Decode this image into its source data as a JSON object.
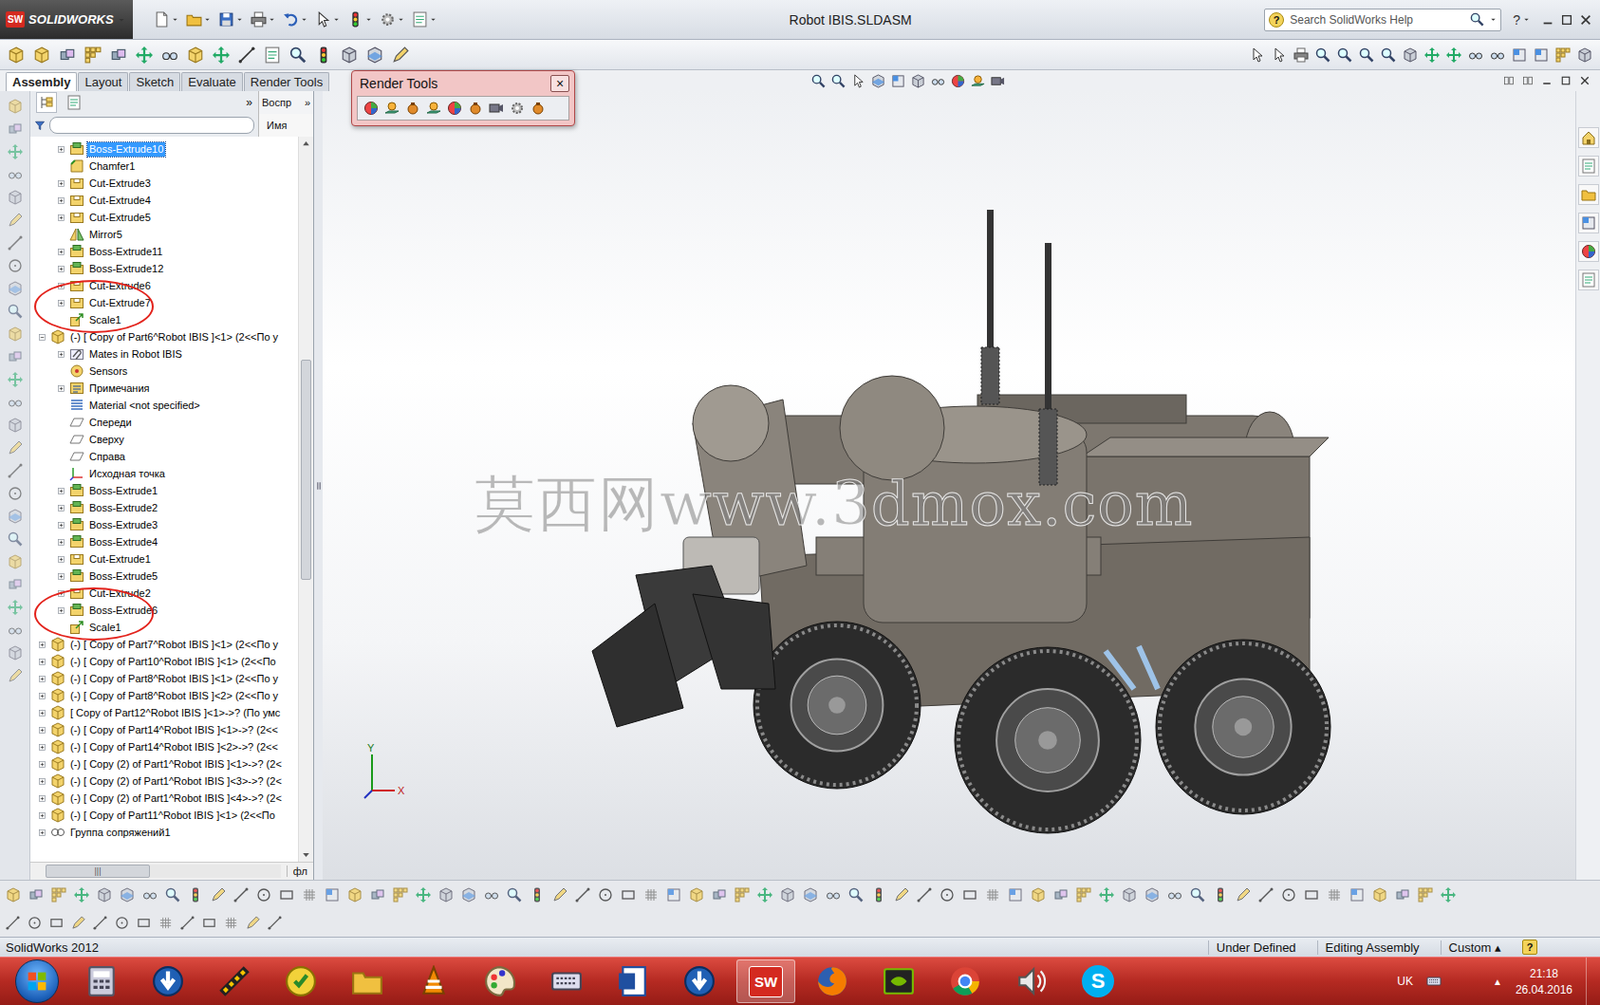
{
  "window": {
    "title": "Robot IBIS.SLDASM",
    "app_name": "SOLIDWORKS",
    "logo_mark": "SW",
    "help_glyph": "?"
  },
  "search": {
    "placeholder": "Search SolidWorks Help"
  },
  "tabs": [
    {
      "label": "Assembly",
      "selected": true
    },
    {
      "label": "Layout",
      "selected": false
    },
    {
      "label": "Sketch",
      "selected": false
    },
    {
      "label": "Evaluate",
      "selected": false
    },
    {
      "label": "Render Tools",
      "selected": false
    }
  ],
  "render_tools_toolbar": {
    "title": "Render Tools",
    "close": "×"
  },
  "panel": {
    "collapse_glyph": "»",
    "display_pane_title": "Воспр",
    "display_pane_column": "Имя",
    "bottom_label": "фл",
    "scroll_thumb": "|||"
  },
  "tree": [
    {
      "label": "Boss-Extrude10",
      "level": 2,
      "kind": "extrude",
      "expandable": true,
      "expanded": false,
      "selected": true,
      "circled": false
    },
    {
      "label": "Chamfer1",
      "level": 2,
      "kind": "chamfer",
      "expandable": false,
      "expanded": false,
      "selected": false,
      "circled": false
    },
    {
      "label": "Cut-Extrude3",
      "level": 2,
      "kind": "cut",
      "expandable": true,
      "expanded": false,
      "selected": false,
      "circled": false
    },
    {
      "label": "Cut-Extrude4",
      "level": 2,
      "kind": "cut",
      "expandable": true,
      "expanded": false,
      "selected": false,
      "circled": false
    },
    {
      "label": "Cut-Extrude5",
      "level": 2,
      "kind": "cut",
      "expandable": true,
      "expanded": false,
      "selected": false,
      "circled": false
    },
    {
      "label": "Mirror5",
      "level": 2,
      "kind": "mirror",
      "expandable": false,
      "expanded": false,
      "selected": false,
      "circled": false
    },
    {
      "label": "Boss-Extrude11",
      "level": 2,
      "kind": "extrude",
      "expandable": true,
      "expanded": false,
      "selected": false,
      "circled": false
    },
    {
      "label": "Boss-Extrude12",
      "level": 2,
      "kind": "extrude",
      "expandable": true,
      "expanded": false,
      "selected": false,
      "circled": false
    },
    {
      "label": "Cut-Extrude6",
      "level": 2,
      "kind": "cut",
      "expandable": true,
      "expanded": false,
      "selected": false,
      "circled": false
    },
    {
      "label": "Cut-Extrude7",
      "level": 2,
      "kind": "cut",
      "expandable": true,
      "expanded": false,
      "selected": false,
      "circled": false
    },
    {
      "label": "Scale1",
      "level": 2,
      "kind": "scale",
      "expandable": false,
      "expanded": false,
      "selected": false,
      "circled": true
    },
    {
      "label": "(-) [ Copy of Part6^Robot IBIS ]<1> (2<<По у",
      "level": 1,
      "kind": "component",
      "expandable": true,
      "expanded": true,
      "selected": false,
      "circled": false
    },
    {
      "label": "Mates in Robot IBIS",
      "level": 2,
      "kind": "mates",
      "expandable": true,
      "expanded": false,
      "selected": false,
      "circled": false
    },
    {
      "label": "Sensors",
      "level": 2,
      "kind": "sensors",
      "expandable": false,
      "expanded": false,
      "selected": false,
      "circled": false
    },
    {
      "label": "Примечания",
      "level": 2,
      "kind": "annotations",
      "expandable": true,
      "expanded": false,
      "selected": false,
      "circled": false
    },
    {
      "label": "Material <not specified>",
      "level": 2,
      "kind": "material",
      "expandable": false,
      "expanded": false,
      "selected": false,
      "circled": false
    },
    {
      "label": "Спереди",
      "level": 2,
      "kind": "plane",
      "expandable": false,
      "expanded": false,
      "selected": false,
      "circled": false
    },
    {
      "label": "Сверху",
      "level": 2,
      "kind": "plane",
      "expandable": false,
      "expanded": false,
      "selected": false,
      "circled": false
    },
    {
      "label": "Справа",
      "level": 2,
      "kind": "plane",
      "expandable": false,
      "expanded": false,
      "selected": false,
      "circled": false
    },
    {
      "label": "Исходная точка",
      "level": 2,
      "kind": "origin",
      "expandable": false,
      "expanded": false,
      "selected": false,
      "circled": false
    },
    {
      "label": "Boss-Extrude1",
      "level": 2,
      "kind": "extrude",
      "expandable": true,
      "expanded": false,
      "selected": false,
      "circled": false
    },
    {
      "label": "Boss-Extrude2",
      "level": 2,
      "kind": "extrude",
      "expandable": true,
      "expanded": false,
      "selected": false,
      "circled": false
    },
    {
      "label": "Boss-Extrude3",
      "level": 2,
      "kind": "extrude",
      "expandable": true,
      "expanded": false,
      "selected": false,
      "circled": false
    },
    {
      "label": "Boss-Extrude4",
      "level": 2,
      "kind": "extrude",
      "expandable": true,
      "expanded": false,
      "selected": false,
      "circled": false
    },
    {
      "label": "Cut-Extrude1",
      "level": 2,
      "kind": "cut",
      "expandable": true,
      "expanded": false,
      "selected": false,
      "circled": false
    },
    {
      "label": "Boss-Extrude5",
      "level": 2,
      "kind": "extrude",
      "expandable": true,
      "expanded": false,
      "selected": false,
      "circled": false
    },
    {
      "label": "Cut-Extrude2",
      "level": 2,
      "kind": "cut",
      "expandable": true,
      "expanded": false,
      "selected": false,
      "circled": false
    },
    {
      "label": "Boss-Extrude6",
      "level": 2,
      "kind": "extrude",
      "expandable": true,
      "expanded": false,
      "selected": false,
      "circled": false
    },
    {
      "label": "Scale1",
      "level": 2,
      "kind": "scale",
      "expandable": false,
      "expanded": false,
      "selected": false,
      "circled": true
    },
    {
      "label": "(-) [ Copy of Part7^Robot IBIS ]<1> (2<<По у",
      "level": 1,
      "kind": "component",
      "expandable": true,
      "expanded": false,
      "selected": false,
      "circled": false
    },
    {
      "label": "(-) [ Copy of Part10^Robot IBIS ]<1> (2<<По",
      "level": 1,
      "kind": "component",
      "expandable": true,
      "expanded": false,
      "selected": false,
      "circled": false
    },
    {
      "label": "(-) [ Copy of Part8^Robot IBIS ]<1> (2<<По у",
      "level": 1,
      "kind": "component",
      "expandable": true,
      "expanded": false,
      "selected": false,
      "circled": false
    },
    {
      "label": "(-) [ Copy of Part8^Robot IBIS ]<2> (2<<По у",
      "level": 1,
      "kind": "component",
      "expandable": true,
      "expanded": false,
      "selected": false,
      "circled": false
    },
    {
      "label": "[ Copy of Part12^Robot IBIS ]<1>->? (По умс",
      "level": 1,
      "kind": "component",
      "expandable": true,
      "expanded": false,
      "selected": false,
      "circled": false
    },
    {
      "label": "(-) [ Copy of Part14^Robot IBIS ]<1>->? (2<<",
      "level": 1,
      "kind": "component",
      "expandable": true,
      "expanded": false,
      "selected": false,
      "circled": false
    },
    {
      "label": "(-) [ Copy of Part14^Robot IBIS ]<2>->? (2<<",
      "level": 1,
      "kind": "component",
      "expandable": true,
      "expanded": false,
      "selected": false,
      "circled": false
    },
    {
      "label": "(-) [ Copy (2) of Part1^Robot IBIS ]<1>->? (2<",
      "level": 1,
      "kind": "component",
      "expandable": true,
      "expanded": false,
      "selected": false,
      "circled": false
    },
    {
      "label": "(-) [ Copy (2) of Part1^Robot IBIS ]<3>->? (2<",
      "level": 1,
      "kind": "component",
      "expandable": true,
      "expanded": false,
      "selected": false,
      "circled": false
    },
    {
      "label": "(-) [ Copy (2) of Part1^Robot IBIS ]<4>->? (2<",
      "level": 1,
      "kind": "component",
      "expandable": true,
      "expanded": false,
      "selected": false,
      "circled": false
    },
    {
      "label": "(-) [ Copy of Part11^Robot IBIS ]<1> (2<<По",
      "level": 1,
      "kind": "component",
      "expandable": true,
      "expanded": false,
      "selected": false,
      "circled": false
    },
    {
      "label": "Группа сопряжений1",
      "level": 1,
      "kind": "mategroup",
      "expandable": true,
      "expanded": false,
      "selected": false,
      "circled": false
    }
  ],
  "viewport": {
    "watermark": "莫西网www.3dmox.com",
    "axes": [
      {
        "label": "Y"
      },
      {
        "label": "X"
      }
    ]
  },
  "status_bar": {
    "app_version": "SolidWorks 2012",
    "items": [
      "Under Defined",
      "Editing Assembly"
    ],
    "units": "Custom",
    "units_arrow": "▴"
  },
  "taskbar": {
    "sw_icon_text": "SW",
    "skype_icon_text": "S",
    "language": "UK",
    "tray_arrow": "▲",
    "time": "21:18",
    "date": "26.04.2016"
  }
}
